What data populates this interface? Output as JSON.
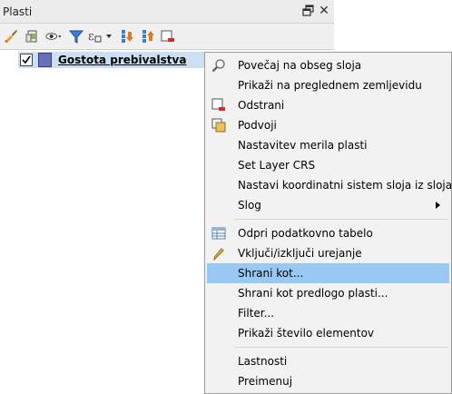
{
  "panel": {
    "title": "Plasti",
    "float_icon": "float-icon",
    "close_icon": "close-icon",
    "toolbar": [
      {
        "name": "style-brush-icon"
      },
      {
        "name": "add-group-icon"
      },
      {
        "name": "visibility-eye-icon"
      },
      {
        "name": "filter-legend-icon"
      },
      {
        "name": "expression-filter-icon"
      },
      {
        "name": "expand-all-icon"
      },
      {
        "name": "collapse-all-icon"
      },
      {
        "name": "remove-layer-icon"
      }
    ],
    "layer": {
      "checked": true,
      "name": "Gostota prebivalstva",
      "color": "#6b6eb8"
    }
  },
  "menu": {
    "items": [
      {
        "label": "Povečaj na obseg sloja",
        "icon": "zoom-icon"
      },
      {
        "label": "Prikaži na preglednem zemljevidu",
        "icon": ""
      },
      {
        "label": "Odstrani",
        "icon": "remove-icon"
      },
      {
        "label": "Podvoji",
        "icon": "duplicate-icon"
      },
      {
        "label": "Nastavitev merila plasti",
        "icon": ""
      },
      {
        "label": "Set Layer CRS",
        "icon": ""
      },
      {
        "label": "Nastavi koordinatni sistem sloja iz sloja",
        "icon": ""
      },
      {
        "label": "Slog",
        "icon": "",
        "submenu": true
      },
      {
        "label": "Odpri podatkovno tabelo",
        "icon": "table-icon"
      },
      {
        "label": "Vključi/izključi urejanje",
        "icon": "pencil-icon"
      },
      {
        "label": "Shrani kot...",
        "icon": "",
        "highlighted": true
      },
      {
        "label": "Shrani kot predlogo plasti...",
        "icon": ""
      },
      {
        "label": "Filter...",
        "icon": ""
      },
      {
        "label": "Prikaži število elementov",
        "icon": ""
      },
      {
        "label": "Lastnosti",
        "icon": ""
      },
      {
        "label": "Preimenuj",
        "icon": ""
      }
    ]
  },
  "colors": {
    "highlight": "#99c8f2",
    "selection": "#cce0f5"
  }
}
